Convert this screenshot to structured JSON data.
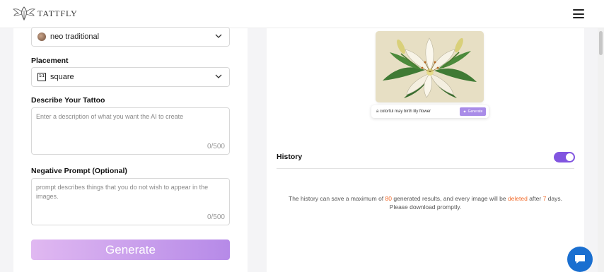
{
  "header": {
    "brand": "TATTFLY",
    "menu_icon": "hamburger-icon"
  },
  "form": {
    "style_select": {
      "value": "neo traditional"
    },
    "placement": {
      "label": "Placement",
      "value": "square",
      "icon": "1:1"
    },
    "description": {
      "label": "Describe Your Tattoo",
      "placeholder": "Enter a description of what you want the AI to create",
      "counter": "0/500"
    },
    "negative": {
      "label": "Negative Prompt (Optional)",
      "placeholder": "prompt describes things that you do not wish to appear in the images.",
      "counter": "0/500"
    },
    "generate_label": "Generate"
  },
  "preview": {
    "prompt": "a colorful may birth lily flower",
    "generate_label": "Generate",
    "image": "lily-flower-illustration"
  },
  "history": {
    "title": "History",
    "toggle_on": true,
    "note": {
      "part1": "The history can save a maximum of ",
      "max": "80",
      "part2": " generated results, and every image will be ",
      "deleted": "deleted",
      "part3": " after ",
      "days": "7",
      "part4": " days.",
      "line2": "Please download promptly."
    }
  },
  "colors": {
    "accent": "#8155e0",
    "highlight": "#f26b2b",
    "chat": "#1a6fd0"
  }
}
